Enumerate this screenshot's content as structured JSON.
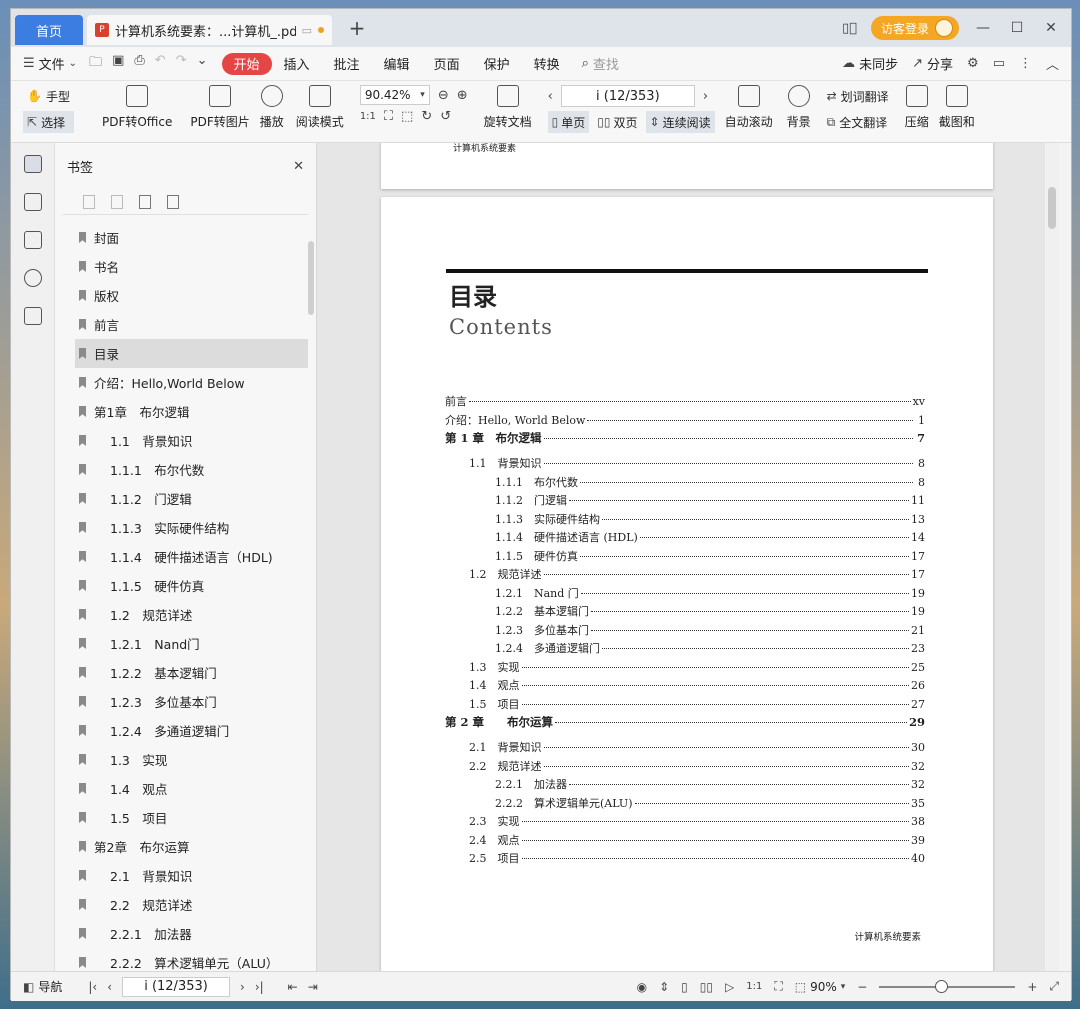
{
  "tabs": {
    "home": "首页",
    "doc_title": "计算机系统要素：...计算机_.pdf",
    "add": "+"
  },
  "titlebar": {
    "guest_login": "访客登录"
  },
  "menu": {
    "file": "文件",
    "items": [
      "开始",
      "插入",
      "批注",
      "编辑",
      "页面",
      "保护",
      "转换"
    ],
    "search_placeholder": "查找",
    "sync": "未同步",
    "share": "分享"
  },
  "toolbar": {
    "hand": "手型",
    "select": "选择",
    "pdf_to_office": "PDF转Office",
    "pdf_to_image": "PDF转图片",
    "play": "播放",
    "read_mode": "阅读模式",
    "zoom": "90.42%",
    "rotate_doc": "旋转文档",
    "page_indicator": "i (12/353)",
    "single_page": "单页",
    "double_page": "双页",
    "continuous": "连续阅读",
    "auto_scroll": "自动滚动",
    "background": "背景",
    "word_translate": "划词翻译",
    "full_translate": "全文翻译",
    "compress": "压缩",
    "screenshot": "截图和"
  },
  "bookmarks": {
    "title": "书签",
    "items": [
      {
        "label": "封面",
        "level": 0
      },
      {
        "label": "书名",
        "level": 0
      },
      {
        "label": "版权",
        "level": 0
      },
      {
        "label": "前言",
        "level": 0
      },
      {
        "label": "目录",
        "level": 0,
        "selected": true
      },
      {
        "label": "介绍：Hello,World Below",
        "level": 0
      },
      {
        "label": "第1章　布尔逻辑",
        "level": 0
      },
      {
        "label": "1.1　背景知识",
        "level": 1
      },
      {
        "label": "1.1.1　布尔代数",
        "level": 1
      },
      {
        "label": "1.1.2　门逻辑",
        "level": 1
      },
      {
        "label": "1.1.3　实际硬件结构",
        "level": 1
      },
      {
        "label": "1.1.4　硬件描述语言（HDL)",
        "level": 1
      },
      {
        "label": "1.1.5　硬件仿真",
        "level": 1
      },
      {
        "label": "1.2　规范详述",
        "level": 1
      },
      {
        "label": "1.2.1　Nand门",
        "level": 1
      },
      {
        "label": "1.2.2　基本逻辑门",
        "level": 1
      },
      {
        "label": "1.2.3　多位基本门",
        "level": 1
      },
      {
        "label": "1.2.4　多通道逻辑门",
        "level": 1
      },
      {
        "label": "1.3　实现",
        "level": 1
      },
      {
        "label": "1.4　观点",
        "level": 1
      },
      {
        "label": "1.5　项目",
        "level": 1
      },
      {
        "label": "第2章　布尔运算",
        "level": 0
      },
      {
        "label": "2.1　背景知识",
        "level": 1
      },
      {
        "label": "2.2　规范详述",
        "level": 1
      },
      {
        "label": "2.2.1　加法器",
        "level": 1
      },
      {
        "label": "2.2.2　算术逻辑单元（ALU）",
        "level": 1
      }
    ]
  },
  "document": {
    "prev_footer": "计算机系统要素",
    "title": "目录",
    "subtitle": "Contents",
    "footer": "计算机系统要素",
    "toc": [
      {
        "label": "前言",
        "page": "xv",
        "level": 0
      },
      {
        "label": "介绍：Hello, World Below",
        "page": "1",
        "level": 0
      },
      {
        "label": "第 1 章　布尔逻辑",
        "page": "7",
        "level": "chapter"
      },
      {
        "label": "1.1　背景知识",
        "page": "8",
        "level": 1
      },
      {
        "label": "1.1.1　布尔代数",
        "page": "8",
        "level": 2
      },
      {
        "label": "1.1.2　门逻辑",
        "page": "11",
        "level": 2
      },
      {
        "label": "1.1.3　实际硬件结构",
        "page": "13",
        "level": 2
      },
      {
        "label": "1.1.4　硬件描述语言 (HDL)",
        "page": "14",
        "level": 2
      },
      {
        "label": "1.1.5　硬件仿真",
        "page": "17",
        "level": 2
      },
      {
        "label": "1.2　规范详述",
        "page": "17",
        "level": 1
      },
      {
        "label": "1.2.1　Nand 门",
        "page": "19",
        "level": 2
      },
      {
        "label": "1.2.2　基本逻辑门",
        "page": "19",
        "level": 2
      },
      {
        "label": "1.2.3　多位基本门",
        "page": "21",
        "level": 2
      },
      {
        "label": "1.2.4　多通道逻辑门",
        "page": "23",
        "level": 2
      },
      {
        "label": "1.3　实现",
        "page": "25",
        "level": 1
      },
      {
        "label": "1.4　观点",
        "page": "26",
        "level": 1
      },
      {
        "label": "1.5　项目",
        "page": "27",
        "level": 1
      },
      {
        "label": "第 2 章　　布尔运算",
        "page": "29",
        "level": "chapter"
      },
      {
        "label": "2.1　背景知识",
        "page": "30",
        "level": 1
      },
      {
        "label": "2.2　规范详述",
        "page": "32",
        "level": 1
      },
      {
        "label": "2.2.1　加法器",
        "page": "32",
        "level": 2
      },
      {
        "label": "2.2.2　算术逻辑单元(ALU)",
        "page": "35",
        "level": 2
      },
      {
        "label": "2.3　实现",
        "page": "38",
        "level": 1
      },
      {
        "label": "2.4　观点",
        "page": "39",
        "level": 1
      },
      {
        "label": "2.5　项目",
        "page": "40",
        "level": 1
      }
    ]
  },
  "statusbar": {
    "nav": "导航",
    "page_indicator": "i (12/353)",
    "zoom": "90%"
  }
}
